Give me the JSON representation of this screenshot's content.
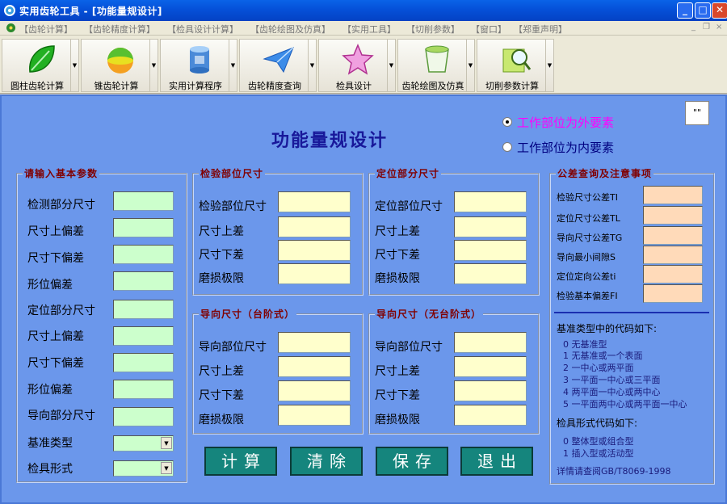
{
  "window": {
    "title": "实用齿轮工具 - [功能量规设计]",
    "min_glyph": "_",
    "max_glyph": "□",
    "close_glyph": "✕"
  },
  "menu": {
    "items": [
      "【齿轮计算】",
      "【齿轮精度计算】",
      "【检具设计计算】",
      "【齿轮绘图及仿真】",
      "【实用工具】",
      "【切削参数】",
      "【窗口】",
      "【郑重声明】"
    ],
    "mdi_controls": [
      "_",
      "❐",
      "×"
    ]
  },
  "toolbar": {
    "buttons": [
      {
        "label": "圆柱齿轮计算",
        "icon": "green-leaf-icon"
      },
      {
        "label": "锥齿轮计算",
        "icon": "colorful-ball-icon"
      },
      {
        "label": "实用计算程序",
        "icon": "database-icon"
      },
      {
        "label": "齿轮精度查询",
        "icon": "paper-plane-icon"
      },
      {
        "label": "检具设计",
        "icon": "star-icon"
      },
      {
        "label": "齿轮绘图及仿真",
        "icon": "teacup-icon"
      },
      {
        "label": "切削参数计算",
        "icon": "magnifier-book-icon"
      }
    ],
    "dropdown_glyph": "▼"
  },
  "form": {
    "title": "功能量规设计",
    "radio_outer": "工作部位为外要素",
    "radio_inner": "工作部位为内要素",
    "radio_selected": "outer",
    "small_box_text": "\"\"",
    "basic": {
      "title": "请输入基本参数",
      "labels": [
        "检测部分尺寸",
        "尺寸上偏差",
        "尺寸下偏差",
        "形位偏差",
        "定位部分尺寸",
        "尺寸上偏差",
        "尺寸下偏差",
        "形位偏差",
        "导向部分尺寸",
        "基准类型",
        "检具形式"
      ]
    },
    "inspect": {
      "title": "检验部位尺寸",
      "labels": [
        "检验部位尺寸",
        "尺寸上差",
        "尺寸下差",
        "磨损极限"
      ]
    },
    "locate": {
      "title": "定位部分尺寸",
      "labels": [
        "定位部位尺寸",
        "尺寸上差",
        "尺寸下差",
        "磨损极限"
      ]
    },
    "guide_step": {
      "title": "导向尺寸（台阶式）",
      "labels": [
        "导向部位尺寸",
        "尺寸上差",
        "尺寸下差",
        "磨损极限"
      ]
    },
    "guide_nostep": {
      "title": "导向尺寸（无台阶式）",
      "labels": [
        "导向部位尺寸",
        "尺寸上差",
        "尺寸下差",
        "磨损极限"
      ]
    },
    "tolerance": {
      "title": "公差查询及注意事项",
      "labels": [
        "检验尺寸公差TI",
        "定位尺寸公差TL",
        "导向尺寸公差TG",
        "导向最小间隙S",
        "定位定向公差ti",
        "检验基本偏差FI"
      ]
    },
    "notes": {
      "datum_header": "基准类型中的代码如下:",
      "datum_codes": [
        "0 无基准型",
        "1 无基准或一个表面",
        "2 一中心或两平面",
        "3 一平面一中心或三平面",
        "4 两平面一中心或两中心",
        "5 一平面两中心或两平面一中心"
      ],
      "gauge_header": "检具形式代码如下:",
      "gauge_codes": [
        "0 整体型或组合型",
        "1 插入型或活动型"
      ],
      "reference": "详情请查阅GB/T8069-1998"
    },
    "actions": {
      "calc": "计算",
      "clear": "清除",
      "save": "保存",
      "exit": "退出"
    }
  },
  "colors": {
    "panel_bg": "#6b97eb",
    "group_title": "#800000",
    "main_title": "#18189a",
    "input_green": "#ccffcc",
    "input_yellow": "#ffffcc",
    "input_peach": "#ffdab9",
    "action_button": "#15857d",
    "radio_outer_text": "#ff00ff",
    "radio_inner_text": "#000080"
  }
}
